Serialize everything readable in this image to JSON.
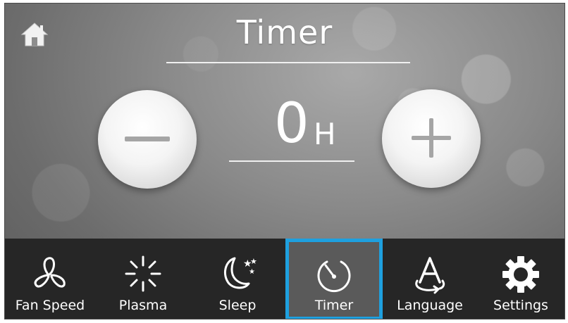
{
  "screen": {
    "title": "Timer"
  },
  "home": {
    "icon": "home-icon"
  },
  "timer": {
    "value": "0",
    "unit": "H",
    "decrease_icon": "minus-icon",
    "increase_icon": "plus-icon"
  },
  "nav": {
    "items": [
      {
        "label": "Fan Speed",
        "icon": "fan-icon",
        "selected": false
      },
      {
        "label": "Plasma",
        "icon": "plasma-icon",
        "selected": false
      },
      {
        "label": "Sleep",
        "icon": "moon-stars-icon",
        "selected": false
      },
      {
        "label": "Timer",
        "icon": "timer-icon",
        "selected": true
      },
      {
        "label": "Language",
        "icon": "language-icon",
        "selected": false
      },
      {
        "label": "Settings",
        "icon": "gear-icon",
        "selected": false
      }
    ]
  },
  "colors": {
    "selected_border": "#1ea0df",
    "bar_background": "#262626",
    "selected_background": "#5a5a5a"
  }
}
